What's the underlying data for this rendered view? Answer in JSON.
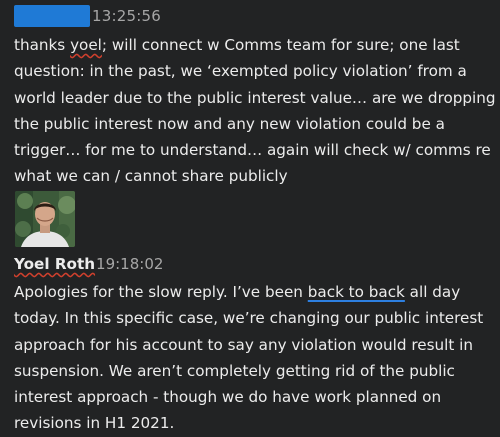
{
  "message1": {
    "timestamp": "13:25:56",
    "text_pre": "thanks ",
    "text_underlined": "yoel",
    "text_post": "; will connect w Comms team for sure; one last question: in the past, we ‘exempted policy violation’ from a world leader due to the public interest value… are we dropping the public interest now and any new violation could be a trigger… for me to understand… again will check w/ comms re what we can / cannot share publicly"
  },
  "message2": {
    "sender": "Yoel Roth",
    "timestamp": "19:18:02",
    "text_pre": "Apologies for the slow reply. I’ve been ",
    "text_underlined": "back to back",
    "text_post": " all day today. In this specific case, we’re changing our public interest approach for his account to say any violation would result in suspension. We aren’t completely getting rid of the public interest approach - though we do have work planned on revisions in H1 2021."
  },
  "colors": {
    "background": "#222324",
    "text": "#ececec",
    "timestamp": "#a6a6a6",
    "redaction": "#1f7ad6",
    "spellcheck": "#d0402d",
    "link_underline": "#2d7fe0"
  }
}
